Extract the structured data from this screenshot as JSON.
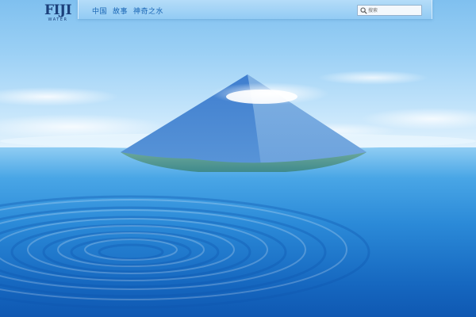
{
  "brand": {
    "name": "FIJI",
    "tagline": "WATER",
    "color": "#1b3f7a"
  },
  "nav": {
    "items": [
      {
        "label": "中国"
      },
      {
        "label": "故事"
      },
      {
        "label": "神奇之水"
      }
    ],
    "link_color": "#1764b4"
  },
  "search": {
    "placeholder": "搜索",
    "icon": "search-icon"
  },
  "hero": {
    "image": "volcanic-island-in-ocean-with-ripples"
  }
}
